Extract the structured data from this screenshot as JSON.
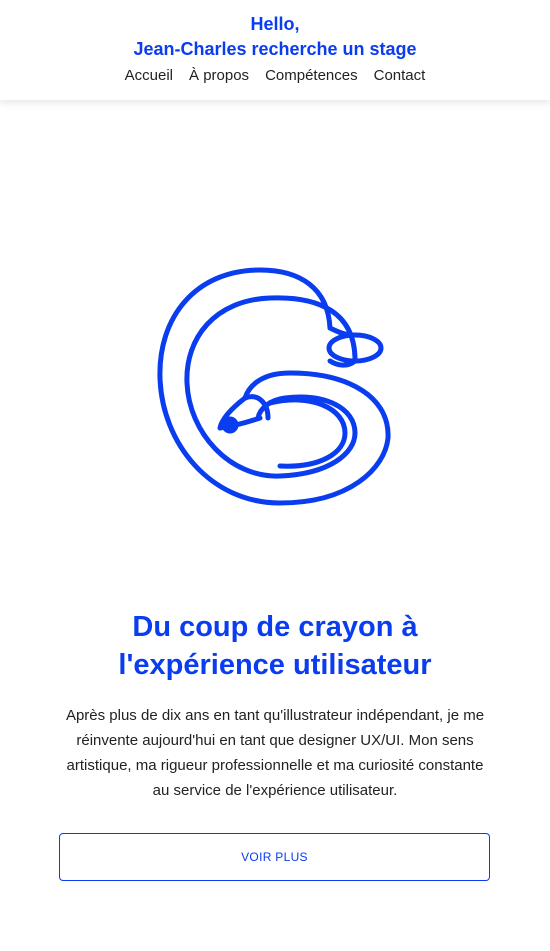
{
  "header": {
    "greeting": "Hello,",
    "tagline": "Jean-Charles recherche un stage"
  },
  "nav": {
    "items": [
      {
        "label": "Accueil"
      },
      {
        "label": "À propos"
      },
      {
        "label": "Compétences"
      },
      {
        "label": "Contact"
      }
    ]
  },
  "hero": {
    "illustration": "pencil-scribble-icon",
    "headline_line1": "Du coup de crayon à",
    "headline_line2": "l'expérience utilisateur",
    "intro": "Après plus de dix ans en tant qu'illustrateur indépendant, je me réinvente aujourd'hui en tant que designer UX/UI. Mon sens artistique, ma rigueur professionnelle et ma curiosité constante au service de l'expérience utilisateur.",
    "cta_label": "VOIR PLUS"
  },
  "colors": {
    "accent": "#0a3cf0",
    "text": "#222222",
    "background": "#ffffff"
  }
}
